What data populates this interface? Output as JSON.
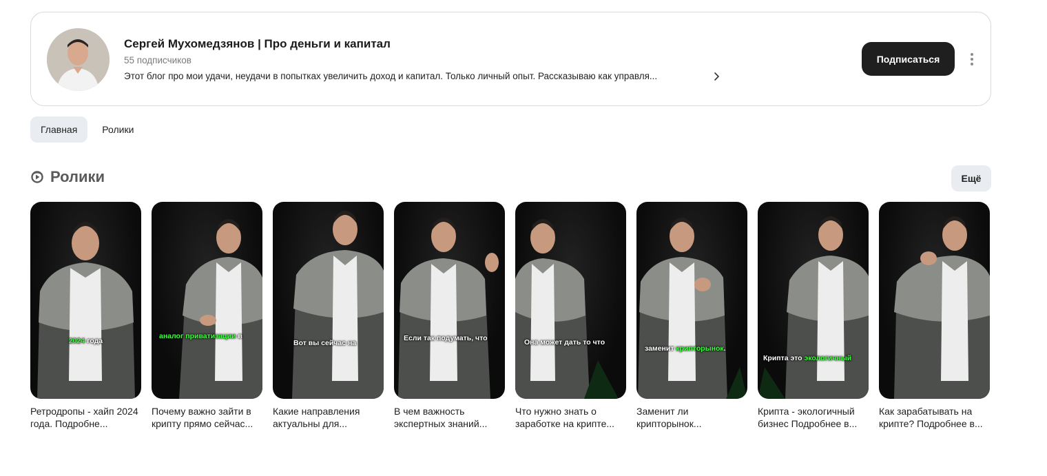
{
  "channel": {
    "name": "Сергей Мухомедзянов | Про деньги и капитал",
    "subscribers": "55 подписчиков",
    "description": "Этот блог про мои удачи, неудачи в попытках увеличить доход и капитал. Только личный опыт. Рассказываю как управля...",
    "subscribe_label": "Подписаться",
    "avatar_icon": "avatar-photo",
    "more_icon": "more-vertical-icon"
  },
  "tabs": [
    {
      "label": "Главная",
      "active": true
    },
    {
      "label": "Ролики",
      "active": false
    }
  ],
  "section": {
    "title": "Ролики",
    "icon": "shorts-icon",
    "more_label": "Ещё"
  },
  "shorts": [
    {
      "title": "Ретродропы - хайп 2024 года. Подробне...",
      "caption_pre": "",
      "caption_hl": "2024",
      "caption_post": " года"
    },
    {
      "title": "Почему важно зайти в крипту прямо сейчас...",
      "caption_pre": "",
      "caption_hl": "аналог приватизации",
      "caption_post": " в"
    },
    {
      "title": "Какие направления актуальны для...",
      "caption_pre": "Вот вы сейчас на",
      "caption_hl": "",
      "caption_post": ""
    },
    {
      "title": "В чем важность экспертных знаний...",
      "caption_pre": "Если так подумать, что",
      "caption_hl": "",
      "caption_post": ""
    },
    {
      "title": "Что нужно знать о заработке на крипте...",
      "caption_pre": "Она может дать то что",
      "caption_hl": "",
      "caption_post": ""
    },
    {
      "title": "Заменит ли крипторынок...",
      "caption_pre": "заменит ",
      "caption_hl": "крипторынок",
      "caption_post": "."
    },
    {
      "title": "Крипта - экологичный бизнес Подробнее в...",
      "caption_pre": "Крипта это ",
      "caption_hl": "экологичный",
      "caption_post": ""
    },
    {
      "title": "Как зарабатывать на крипте? Подробнее в...",
      "caption_pre": "",
      "caption_hl": "",
      "caption_post": ""
    }
  ],
  "colors": {
    "accent_dark": "#1f1f1f",
    "tab_active_bg": "#e9ecf0",
    "caption_highlight": "#3dff3d"
  }
}
